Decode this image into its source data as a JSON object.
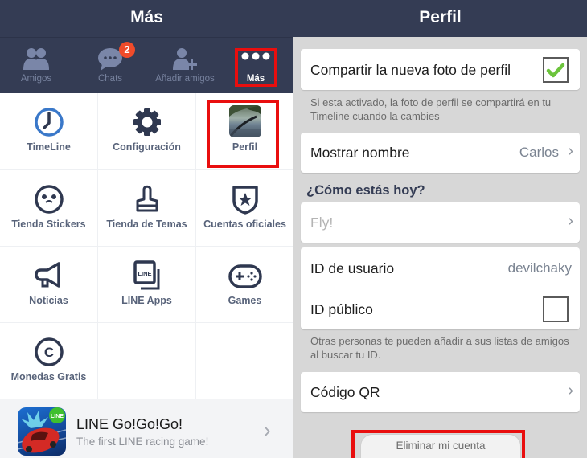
{
  "left": {
    "title": "Más",
    "tabs": [
      {
        "label": "Amigos",
        "icon": "friends-icon"
      },
      {
        "label": "Chats",
        "icon": "chat-bubble-icon",
        "badge": "2"
      },
      {
        "label": "Añadir amigos",
        "icon": "add-friend-icon"
      },
      {
        "label": "Más",
        "icon": "more-dots-icon",
        "active": true
      }
    ],
    "grid": [
      {
        "label": "TimeLine",
        "icon": "clock-icon"
      },
      {
        "label": "Configuración",
        "icon": "gear-icon"
      },
      {
        "label": "Perfil",
        "icon": "profile-photo-icon"
      },
      {
        "label": "Tienda Stickers",
        "icon": "sticker-face-icon"
      },
      {
        "label": "Tienda de Temas",
        "icon": "paint-brush-icon"
      },
      {
        "label": "Cuentas oficiales",
        "icon": "shield-star-icon"
      },
      {
        "label": "Noticias",
        "icon": "megaphone-icon"
      },
      {
        "label": "LINE Apps",
        "icon": "line-apps-icon",
        "icon_text": "LINE"
      },
      {
        "label": "Games",
        "icon": "gamepad-icon"
      },
      {
        "label": "Monedas Gratis",
        "icon": "coin-icon",
        "icon_text": "C"
      }
    ],
    "promo": {
      "title": "LINE Go!Go!Go!",
      "subtitle": "The first LINE racing game!",
      "badge_text": "LINE",
      "chevron": "›"
    }
  },
  "right": {
    "title": "Perfil",
    "share_photo": {
      "label": "Compartir la nueva foto de perfil",
      "checked": true,
      "hint": "Si esta activado, la foto de perfil se compartirá en tu Timeline cuando la cambies"
    },
    "display_name": {
      "label": "Mostrar nombre",
      "value": "Carlos",
      "chevron": "›"
    },
    "status_section": {
      "title": "¿Cómo estás hoy?",
      "placeholder": "Fly!",
      "chevron": "›"
    },
    "user_id": {
      "label": "ID de usuario",
      "value": "devilchaky"
    },
    "public_id": {
      "label": "ID público",
      "checked": false,
      "hint": "Otras personas te pueden añadir a sus listas de amigos al buscar tu ID."
    },
    "qr_code": {
      "label": "Código QR",
      "chevron": "›"
    },
    "delete_account": {
      "label": "Eliminar mi cuenta"
    }
  },
  "colors": {
    "header": "#343c54",
    "highlight": "#e90e0e",
    "badge": "#ef4b2a",
    "check": "#6cc43c",
    "icon": "#2f3850",
    "tab_icon": "#7a86a8"
  }
}
